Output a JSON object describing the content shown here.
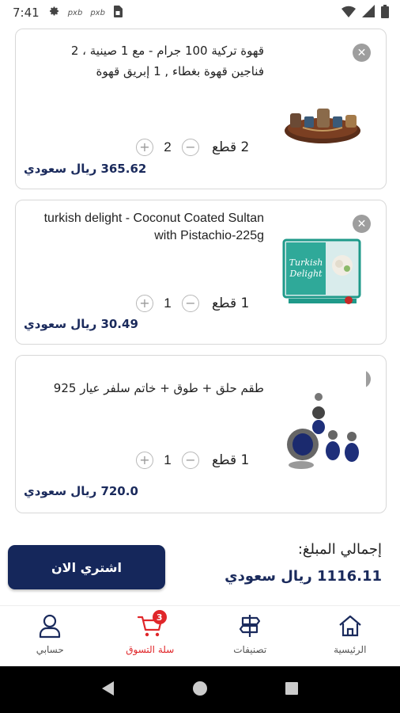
{
  "status_bar": {
    "time": "7:41",
    "mini_labels": [
      "pxb",
      "pxb"
    ]
  },
  "cart_items": [
    {
      "title": "قهوة تركية 100 جرام - مع 1 صينية ، 2 فناجين قهوة بغطاء , 1 إبريق قهوة",
      "quantity": "2",
      "unit_label": "2 قطع",
      "price": "365.62 ريال سعودي"
    },
    {
      "title": "turkish delight - Coconut Coated Sultan with Pistachio-225g",
      "quantity": "1",
      "unit_label": "1 قطع",
      "price": "30.49 ريال سعودي"
    },
    {
      "title": "طقم حلق + طوق + خاتم سلفر عيار 925",
      "quantity": "1",
      "unit_label": "1 قطع",
      "price": "720.0 ريال سعودي"
    }
  ],
  "total": {
    "label": "إجمالي المبلغ:",
    "value": "1116.11 ريال سعودي"
  },
  "buy_button": "اشتري الان",
  "bottom_nav": {
    "home": "الرئيسية",
    "categories": "تصنيفات",
    "cart": "سلة التسوق",
    "cart_badge": "3",
    "account": "حسابي"
  },
  "colors": {
    "primary": "#15275b",
    "price": "#1a2a5c",
    "accent": "#e0262a"
  },
  "icons": {
    "status": [
      "gear-icon",
      "sim-icon",
      "wifi-icon",
      "signal-icon",
      "battery-icon"
    ],
    "nav": [
      "home-icon",
      "categories-icon",
      "cart-icon",
      "user-icon"
    ]
  }
}
